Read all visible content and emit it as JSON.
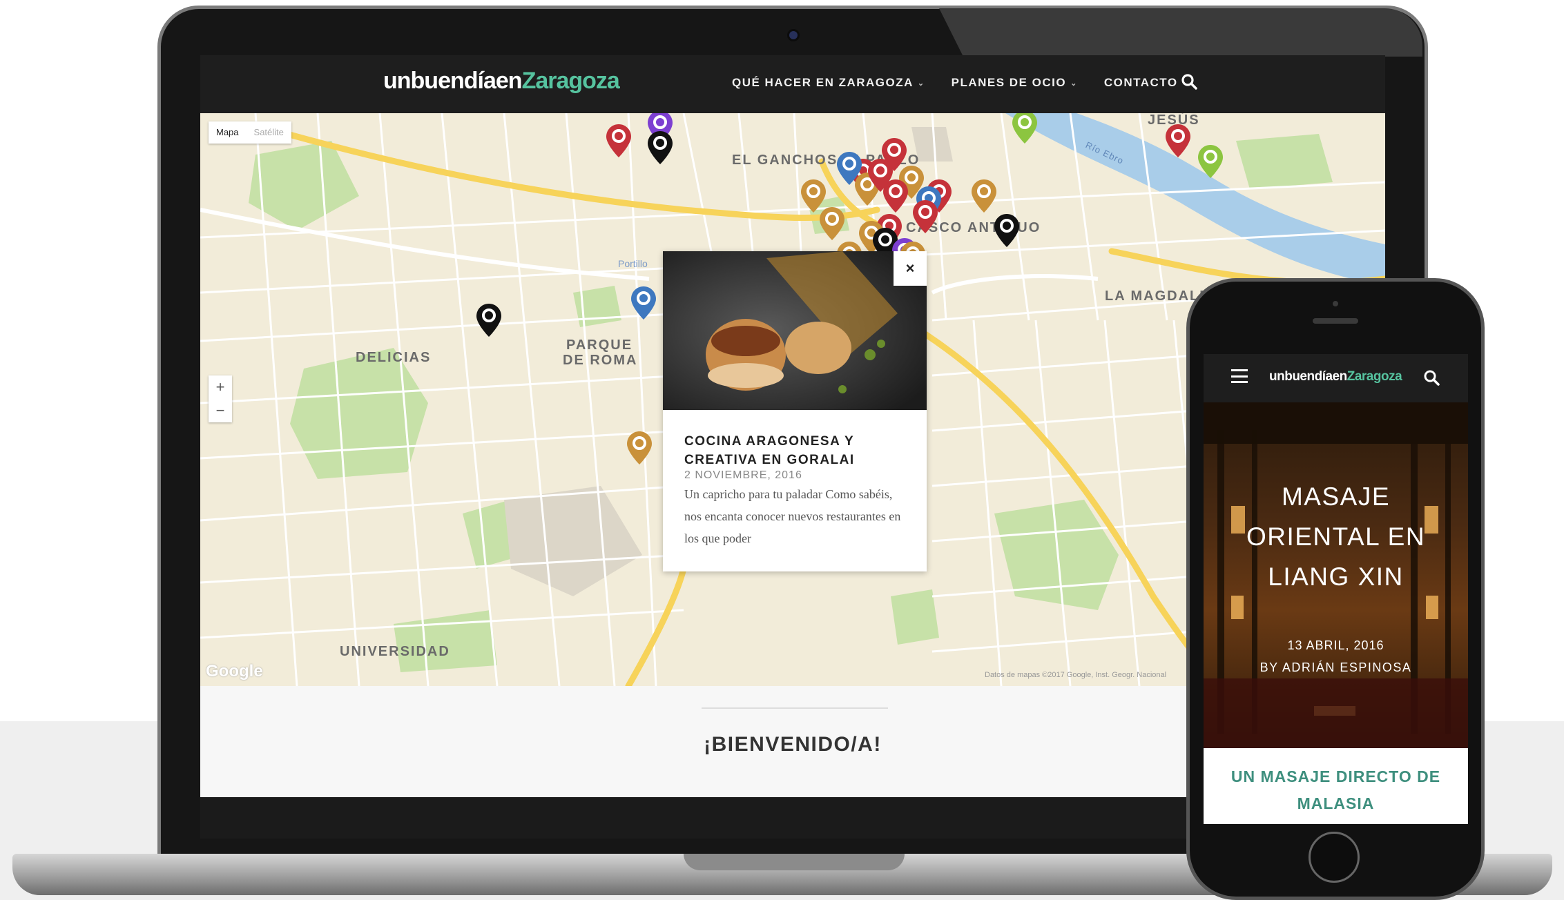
{
  "site": {
    "logo_part1": "unbuendíaen",
    "logo_part2": "Zaragoza",
    "accent_color": "#56c39f"
  },
  "nav": {
    "items": [
      {
        "label": "QUÉ HACER EN ZARAGOZA",
        "has_dropdown": true
      },
      {
        "label": "PLANES DE OCIO",
        "has_dropdown": true
      },
      {
        "label": "CONTACTO",
        "has_dropdown": false
      }
    ],
    "search_icon": "search-icon"
  },
  "map": {
    "type_options": [
      "Mapa",
      "Satélite"
    ],
    "selected_type": "Mapa",
    "zoom_in": "+",
    "zoom_out": "−",
    "labels": {
      "el_gancho": "EL GANCHO",
      "san_pablo": "SAN PABLO",
      "casco": "CASCO ANTIGUO",
      "delicias": "DELICIAS",
      "parque_1": "PARQUE",
      "parque_2": "DE ROMA",
      "la_magdalena": "LA MAGDALENA",
      "universidad": "UNIVERSIDAD",
      "portillo": "Portillo",
      "rio_ebro": "Río Ebro",
      "jesus": "JESÚS"
    },
    "google_logo": "Google",
    "attribution": "Datos de mapas ©2017 Google, Inst. Geogr. Nacional",
    "marker_colors": {
      "red": "#c5323a",
      "gold": "#c9913a",
      "black": "#111111",
      "blue": "#3e78bf",
      "purple": "#7d3fd1",
      "green": "#8cc540"
    }
  },
  "popup": {
    "close_label": "×",
    "title": "COCINA ARAGONESA Y CREATIVA EN GORALAI",
    "date": "2 NOVIEMBRE, 2016",
    "excerpt": "Un capricho para tu paladar Como sabéis, nos encanta conocer nuevos restaurantes en los que poder"
  },
  "welcome": {
    "heading": "¡BIENVENIDO/A!"
  },
  "phone": {
    "logo_part1": "unbuendíaen",
    "logo_part2": "Zaragoza",
    "menu_icon": "hamburger-menu-icon",
    "search_icon": "search-icon",
    "hero_title": "MASAJE ORIENTAL EN LIANG XIN",
    "hero_date": "13 ABRIL, 2016",
    "hero_author": "BY ADRIÁN ESPINOSA",
    "subheading": "UN MASAJE DIRECTO DE MALASIA"
  }
}
